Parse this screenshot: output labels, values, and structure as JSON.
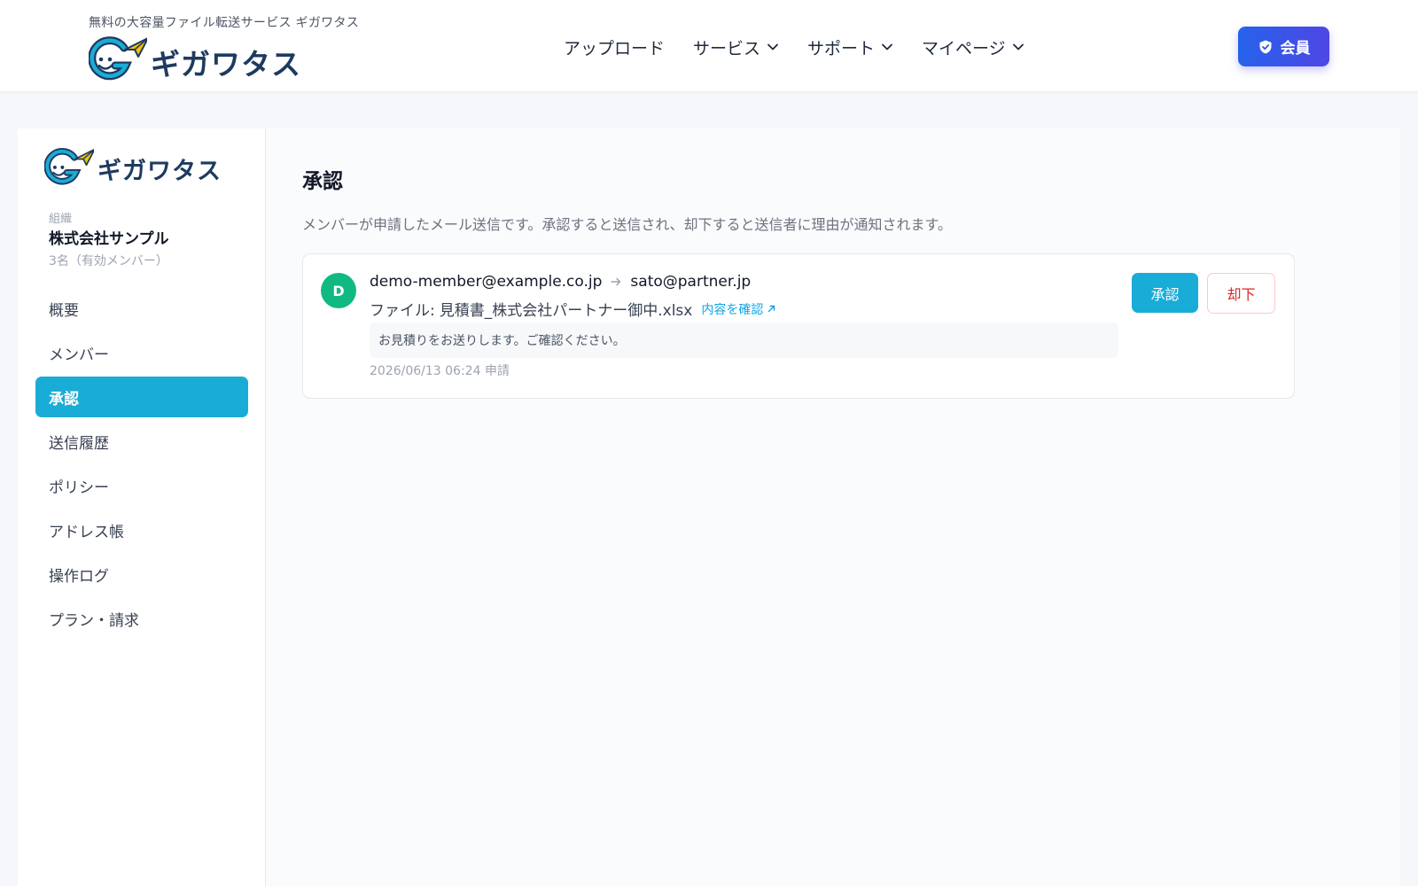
{
  "header": {
    "tagline": "無料の大容量ファイル転送サービス ギガワタス",
    "brand": "ギガワタス",
    "nav": [
      {
        "label": "アップロード",
        "icon": ""
      },
      {
        "label": "サービス",
        "icon": "chevron-down-icon"
      },
      {
        "label": "サポート",
        "icon": "chevron-down-icon"
      },
      {
        "label": "マイページ",
        "icon": "chevron-down-icon"
      }
    ],
    "member_label": "会員",
    "member_icon": "shield-check-icon"
  },
  "sidebar": {
    "brand": "ギガワタス",
    "org_label": "組織",
    "org_name": "株式会社サンプル",
    "member_count": "3名（有効メンバー）",
    "items": [
      {
        "label": "概要"
      },
      {
        "label": "メンバー"
      },
      {
        "label": "承認",
        "active": true
      },
      {
        "label": "送信履歴"
      },
      {
        "label": "ポリシー"
      },
      {
        "label": "アドレス帳"
      },
      {
        "label": "操作ログ"
      },
      {
        "label": "プラン・請求"
      }
    ]
  },
  "main": {
    "title": "承認",
    "description": "メンバーが申請したメール送信です。承認すると送信され、却下すると送信者に理由が通知されます。",
    "request": {
      "avatar": "D",
      "from": "demo-member@example.co.jp",
      "to": "sato@partner.jp",
      "file_prefix": "ファイル:",
      "file_name": "見積書_株式会社パートナー御中.xlsx",
      "check_link": "内容を確認",
      "message": "お見積りをお送りします。ご確認ください。",
      "timestamp": "2026/06/13 06:24 申請",
      "approve_label": "承認",
      "reject_label": "却下"
    }
  },
  "colors": {
    "accent": "#19acd6",
    "brand_navy": "#1e3a5f",
    "member_gradient_start": "#2563eb",
    "member_gradient_end": "#4f46e5",
    "avatar": "#10b981",
    "reject": "#dc2626"
  }
}
